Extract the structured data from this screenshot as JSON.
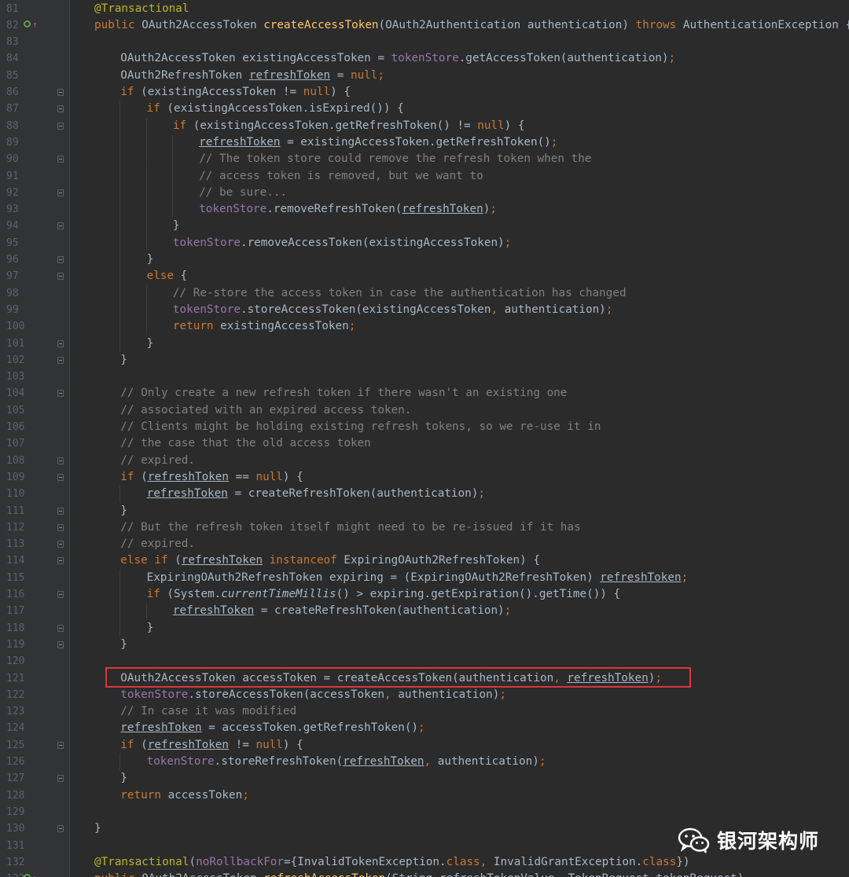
{
  "editor": {
    "theme_colors": {
      "background": "#2b2b2b",
      "keyword": "#cc7832",
      "method": "#ffc66d",
      "annotation": "#bbb529",
      "field": "#9876aa",
      "comment": "#808080",
      "text": "#a9b7c6",
      "highlight_box": "#d9363e"
    },
    "lines": [
      {
        "n": "81",
        "indent": 0,
        "fold": false,
        "segs": [
          [
            "an",
            "@Transactional"
          ]
        ]
      },
      {
        "n": "82",
        "indent": 0,
        "fold": false,
        "markers": true,
        "segs": [
          [
            "kw",
            "public "
          ],
          [
            "t",
            "OAuth2AccessToken "
          ],
          [
            "fn",
            "createAccessToken"
          ],
          [
            "t",
            "(OAuth2Authentication authentication) "
          ],
          [
            "kw",
            "throws "
          ],
          [
            "t",
            "AuthenticationException {"
          ]
        ]
      },
      {
        "n": "83",
        "indent": 0,
        "fold": false,
        "segs": []
      },
      {
        "n": "84",
        "indent": 1,
        "fold": false,
        "segs": [
          [
            "t",
            "OAuth2AccessToken existingAccessToken = "
          ],
          [
            "fd",
            "tokenStore"
          ],
          [
            "t",
            ".getAccessToken(authentication)"
          ],
          [
            "kw",
            ";"
          ]
        ]
      },
      {
        "n": "85",
        "indent": 1,
        "fold": false,
        "segs": [
          [
            "t",
            "OAuth2RefreshToken "
          ],
          [
            "ul",
            "refreshToken"
          ],
          [
            "t",
            " = "
          ],
          [
            "kw",
            "null;"
          ]
        ]
      },
      {
        "n": "86",
        "indent": 1,
        "fold": true,
        "segs": [
          [
            "kw",
            "if "
          ],
          [
            "t",
            "(existingAccessToken != "
          ],
          [
            "kw",
            "null"
          ],
          [
            "t",
            ") {"
          ]
        ]
      },
      {
        "n": "87",
        "indent": 2,
        "fold": true,
        "segs": [
          [
            "kw",
            "if "
          ],
          [
            "t",
            "(existingAccessToken.isExpired()) {"
          ]
        ]
      },
      {
        "n": "88",
        "indent": 3,
        "fold": true,
        "segs": [
          [
            "kw",
            "if "
          ],
          [
            "t",
            "(existingAccessToken.getRefreshToken() != "
          ],
          [
            "kw",
            "null"
          ],
          [
            "t",
            ") {"
          ]
        ]
      },
      {
        "n": "89",
        "indent": 4,
        "fold": false,
        "segs": [
          [
            "ul",
            "refreshToken"
          ],
          [
            "t",
            " = existingAccessToken.getRefreshToken()"
          ],
          [
            "kw",
            ";"
          ]
        ]
      },
      {
        "n": "90",
        "indent": 4,
        "fold": true,
        "segs": [
          [
            "cm",
            "// The token store could remove the refresh token when the"
          ]
        ]
      },
      {
        "n": "91",
        "indent": 4,
        "fold": false,
        "segs": [
          [
            "cm",
            "// access token is removed, but we want to"
          ]
        ]
      },
      {
        "n": "92",
        "indent": 4,
        "fold": true,
        "segs": [
          [
            "cm",
            "// be sure..."
          ]
        ]
      },
      {
        "n": "93",
        "indent": 4,
        "fold": false,
        "segs": [
          [
            "fd",
            "tokenStore"
          ],
          [
            "t",
            ".removeRefreshToken("
          ],
          [
            "ul",
            "refreshToken"
          ],
          [
            "t",
            ")"
          ],
          [
            "kw",
            ";"
          ]
        ]
      },
      {
        "n": "94",
        "indent": 3,
        "fold": true,
        "segs": [
          [
            "t",
            "}"
          ]
        ]
      },
      {
        "n": "95",
        "indent": 3,
        "fold": false,
        "segs": [
          [
            "fd",
            "tokenStore"
          ],
          [
            "t",
            ".removeAccessToken(existingAccessToken)"
          ],
          [
            "kw",
            ";"
          ]
        ]
      },
      {
        "n": "96",
        "indent": 2,
        "fold": true,
        "segs": [
          [
            "t",
            "}"
          ]
        ]
      },
      {
        "n": "97",
        "indent": 2,
        "fold": true,
        "segs": [
          [
            "kw",
            "else "
          ],
          [
            "t",
            "{"
          ]
        ]
      },
      {
        "n": "98",
        "indent": 3,
        "fold": false,
        "segs": [
          [
            "cm",
            "// Re-store the access token in case the authentication has changed"
          ]
        ]
      },
      {
        "n": "99",
        "indent": 3,
        "fold": false,
        "segs": [
          [
            "fd",
            "tokenStore"
          ],
          [
            "t",
            ".storeAccessToken(existingAccessToken"
          ],
          [
            "kw",
            ", "
          ],
          [
            "t",
            "authentication)"
          ],
          [
            "kw",
            ";"
          ]
        ]
      },
      {
        "n": "100",
        "indent": 3,
        "fold": false,
        "segs": [
          [
            "kw",
            "return "
          ],
          [
            "t",
            "existingAccessToken"
          ],
          [
            "kw",
            ";"
          ]
        ]
      },
      {
        "n": "101",
        "indent": 2,
        "fold": true,
        "segs": [
          [
            "t",
            "}"
          ]
        ]
      },
      {
        "n": "102",
        "indent": 1,
        "fold": true,
        "segs": [
          [
            "t",
            "}"
          ]
        ]
      },
      {
        "n": "103",
        "indent": 0,
        "fold": false,
        "segs": []
      },
      {
        "n": "104",
        "indent": 1,
        "fold": true,
        "segs": [
          [
            "cm",
            "// Only create a new refresh token if there wasn't an existing one"
          ]
        ]
      },
      {
        "n": "105",
        "indent": 1,
        "fold": false,
        "segs": [
          [
            "cm",
            "// associated with an expired access token."
          ]
        ]
      },
      {
        "n": "106",
        "indent": 1,
        "fold": false,
        "segs": [
          [
            "cm",
            "// Clients might be holding existing refresh tokens, so we re-use it in"
          ]
        ]
      },
      {
        "n": "107",
        "indent": 1,
        "fold": false,
        "segs": [
          [
            "cm",
            "// the case that the old access token"
          ]
        ]
      },
      {
        "n": "108",
        "indent": 1,
        "fold": true,
        "segs": [
          [
            "cm",
            "// expired."
          ]
        ]
      },
      {
        "n": "109",
        "indent": 1,
        "fold": true,
        "segs": [
          [
            "kw",
            "if "
          ],
          [
            "t",
            "("
          ],
          [
            "ul",
            "refreshToken"
          ],
          [
            "t",
            " == "
          ],
          [
            "kw",
            "null"
          ],
          [
            "t",
            ") {"
          ]
        ]
      },
      {
        "n": "110",
        "indent": 2,
        "fold": false,
        "segs": [
          [
            "ul",
            "refreshToken"
          ],
          [
            "t",
            " = createRefreshToken(authentication)"
          ],
          [
            "kw",
            ";"
          ]
        ]
      },
      {
        "n": "111",
        "indent": 1,
        "fold": true,
        "segs": [
          [
            "t",
            "}"
          ]
        ]
      },
      {
        "n": "112",
        "indent": 1,
        "fold": true,
        "segs": [
          [
            "cm",
            "// But the refresh token itself might need to be re-issued if it has"
          ]
        ]
      },
      {
        "n": "113",
        "indent": 1,
        "fold": true,
        "segs": [
          [
            "cm",
            "// expired."
          ]
        ]
      },
      {
        "n": "114",
        "indent": 1,
        "fold": true,
        "segs": [
          [
            "kw",
            "else if "
          ],
          [
            "t",
            "("
          ],
          [
            "ul",
            "refreshToken"
          ],
          [
            "t",
            " "
          ],
          [
            "kw",
            "instanceof "
          ],
          [
            "t",
            "ExpiringOAuth2RefreshToken) {"
          ]
        ]
      },
      {
        "n": "115",
        "indent": 2,
        "fold": false,
        "segs": [
          [
            "t",
            "ExpiringOAuth2RefreshToken expiring = (ExpiringOAuth2RefreshToken) "
          ],
          [
            "ul",
            "refreshToken"
          ],
          [
            "kw",
            ";"
          ]
        ]
      },
      {
        "n": "116",
        "indent": 2,
        "fold": true,
        "segs": [
          [
            "kw",
            "if "
          ],
          [
            "t",
            "(System."
          ],
          [
            "it",
            "currentTimeMillis"
          ],
          [
            "t",
            "() > expiring.getExpiration().getTime()) {"
          ]
        ]
      },
      {
        "n": "117",
        "indent": 3,
        "fold": false,
        "segs": [
          [
            "ul",
            "refreshToken"
          ],
          [
            "t",
            " = createRefreshToken(authentication)"
          ],
          [
            "kw",
            ";"
          ]
        ]
      },
      {
        "n": "118",
        "indent": 2,
        "fold": true,
        "segs": [
          [
            "t",
            "}"
          ]
        ]
      },
      {
        "n": "119",
        "indent": 1,
        "fold": true,
        "segs": [
          [
            "t",
            "}"
          ]
        ]
      },
      {
        "n": "120",
        "indent": 0,
        "fold": false,
        "segs": []
      },
      {
        "n": "121",
        "indent": 1,
        "fold": false,
        "segs": [
          [
            "t",
            "OAuth2AccessToken accessToken = createAccessToken(authentication"
          ],
          [
            "kw",
            ", "
          ],
          [
            "ul",
            "refreshToken"
          ],
          [
            "t",
            ")"
          ],
          [
            "kw",
            ";"
          ]
        ]
      },
      {
        "n": "122",
        "indent": 1,
        "fold": false,
        "segs": [
          [
            "fd",
            "tokenStore"
          ],
          [
            "t",
            ".storeAccessToken(accessToken"
          ],
          [
            "kw",
            ", "
          ],
          [
            "t",
            "authentication)"
          ],
          [
            "kw",
            ";"
          ]
        ]
      },
      {
        "n": "123",
        "indent": 1,
        "fold": false,
        "segs": [
          [
            "cm",
            "// In case it was modified"
          ]
        ]
      },
      {
        "n": "124",
        "indent": 1,
        "fold": false,
        "segs": [
          [
            "ul",
            "refreshToken"
          ],
          [
            "t",
            " = accessToken.getRefreshToken()"
          ],
          [
            "kw",
            ";"
          ]
        ]
      },
      {
        "n": "125",
        "indent": 1,
        "fold": true,
        "segs": [
          [
            "kw",
            "if "
          ],
          [
            "t",
            "("
          ],
          [
            "ul",
            "refreshToken"
          ],
          [
            "t",
            " != "
          ],
          [
            "kw",
            "null"
          ],
          [
            "t",
            ") {"
          ]
        ]
      },
      {
        "n": "126",
        "indent": 2,
        "fold": false,
        "segs": [
          [
            "fd",
            "tokenStore"
          ],
          [
            "t",
            ".storeRefreshToken("
          ],
          [
            "ul",
            "refreshToken"
          ],
          [
            "kw",
            ", "
          ],
          [
            "t",
            "authentication)"
          ],
          [
            "kw",
            ";"
          ]
        ]
      },
      {
        "n": "127",
        "indent": 1,
        "fold": true,
        "segs": [
          [
            "t",
            "}"
          ]
        ]
      },
      {
        "n": "128",
        "indent": 1,
        "fold": false,
        "segs": [
          [
            "kw",
            "return "
          ],
          [
            "t",
            "accessToken"
          ],
          [
            "kw",
            ";"
          ]
        ]
      },
      {
        "n": "129",
        "indent": 0,
        "fold": false,
        "segs": []
      },
      {
        "n": "130",
        "indent": 0,
        "fold": true,
        "segs": [
          [
            "t",
            "}"
          ]
        ]
      },
      {
        "n": "131",
        "indent": 0,
        "fold": false,
        "segs": []
      },
      {
        "n": "132",
        "indent": 0,
        "fold": false,
        "segs": [
          [
            "an",
            "@Transactional"
          ],
          [
            "t",
            "("
          ],
          [
            "fd",
            "noRollbackFor"
          ],
          [
            "t",
            "={InvalidTokenException."
          ],
          [
            "kw",
            "class"
          ],
          [
            "kw",
            ", "
          ],
          [
            "t",
            "InvalidGrantException."
          ],
          [
            "kw",
            "class"
          ],
          [
            "t",
            "})"
          ]
        ]
      },
      {
        "n": "133",
        "indent": 0,
        "fold": false,
        "markers": true,
        "segs": [
          [
            "kw",
            "public "
          ],
          [
            "t",
            "OAuth2AccessToken "
          ],
          [
            "fn",
            "refreshAccessToken"
          ],
          [
            "t",
            "(String refreshTokenValue"
          ],
          [
            "kw",
            ", "
          ],
          [
            "t",
            "TokenRequest tokenRequest)"
          ]
        ]
      }
    ]
  },
  "watermark": {
    "icon": "wechat-icon",
    "text": "银河架构师"
  }
}
